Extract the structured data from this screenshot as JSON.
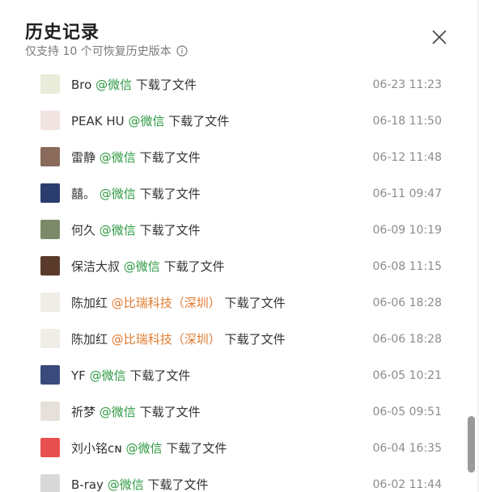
{
  "header": {
    "title": "历史记录",
    "subtitle": "仅支持 10 个可恢复历史版本"
  },
  "icons": {
    "info": "info-circle-icon",
    "close": "close-x-icon"
  },
  "colors": {
    "wechat_green": "#2e9a43",
    "org_orange": "#e07b2f"
  },
  "rows": [
    {
      "name": "Bro",
      "source": "@微信",
      "action": "下载了文件",
      "time": "06-23 11:23",
      "avatar": "#e8ecd8"
    },
    {
      "name": "PEAK HU",
      "source": "@微信",
      "action": "下载了文件",
      "time": "06-18 11:50",
      "avatar": "#f1e4e0"
    },
    {
      "name": "雷静",
      "source": "@微信",
      "action": "下载了文件",
      "time": "06-12 11:48",
      "avatar": "#8a6a5a"
    },
    {
      "name": "囍。",
      "source": "@微信",
      "action": "下载了文件",
      "time": "06-11 09:47",
      "avatar": "#2a3d6e"
    },
    {
      "name": "何久",
      "source": "@微信",
      "action": "下载了文件",
      "time": "06-09 10:19",
      "avatar": "#7d8a6a"
    },
    {
      "name": "保洁大叔",
      "source": "@微信",
      "action": "下载了文件",
      "time": "06-08 11:15",
      "avatar": "#5a3a2a"
    },
    {
      "name": "陈加红",
      "source": "@比瑞科技（深圳）",
      "action": "下载了文件",
      "time": "06-06 18:28",
      "avatar": "#f0ece6"
    },
    {
      "name": "陈加红",
      "source": "@比瑞科技（深圳）",
      "action": "下载了文件",
      "time": "06-06 18:28",
      "avatar": "#f0ece6"
    },
    {
      "name": "YF",
      "source": "@微信",
      "action": "下载了文件",
      "time": "06-05 10:21",
      "avatar": "#3a4a7a"
    },
    {
      "name": "祈梦",
      "source": "@微信",
      "action": "下载了文件",
      "time": "06-05 09:51",
      "avatar": "#e6e0da"
    },
    {
      "name": "刘小铭ᴄɴ",
      "source": "@微信",
      "action": "下载了文件",
      "time": "06-04 16:35",
      "avatar": "#e85050"
    },
    {
      "name": "B-ray",
      "source": "@微信",
      "action": "下载了文件",
      "time": "06-02 11:44",
      "avatar": "#d8d8d8"
    }
  ]
}
